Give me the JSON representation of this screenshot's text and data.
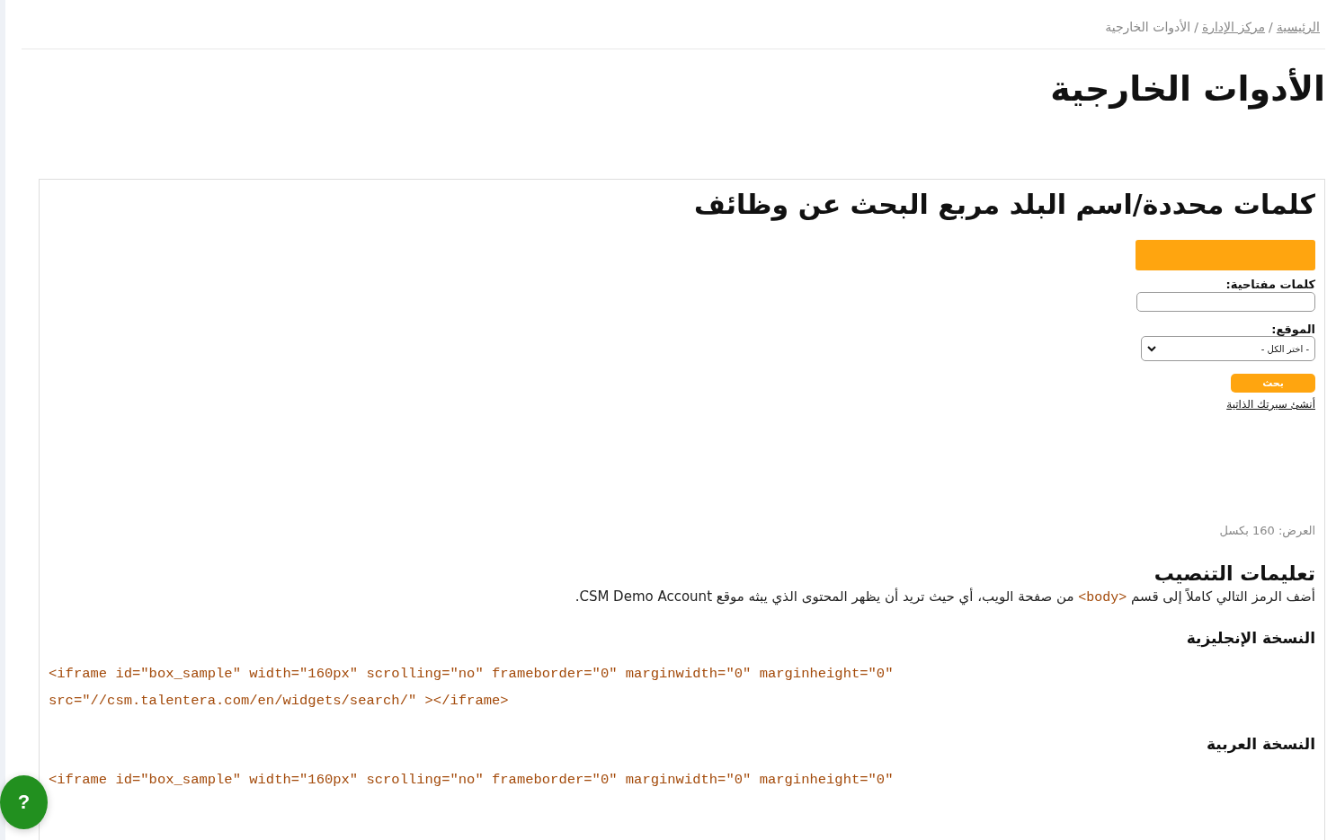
{
  "breadcrumb_separator": "/",
  "breadcrumb": [
    {
      "label": "الرئيسية",
      "link": true
    },
    {
      "label": "مركز الإدارة",
      "link": true
    },
    {
      "label": "الأدوات الخارجية",
      "link": false
    }
  ],
  "page_title": "الأدوات الخارجية",
  "widget": {
    "title": "كلمات محددة/اسم البلد مربع البحث عن وظائف",
    "keywords_label": "كلمات مفتاحية:",
    "location_label": "الموقع:",
    "location_value": "- اختر الكل -",
    "search_button": "بحث",
    "cv_link": "أنشئ سيرتك الذاتية",
    "width_note": "العرض: 160 بكسل"
  },
  "instructions": {
    "title": "تعليمات التنصيب",
    "text": [
      {
        "kind": "text",
        "text": "أضف الرمز التالي كاملاً إلى قسم "
      },
      {
        "kind": "code",
        "text": "<body>"
      },
      {
        "kind": "text",
        "text": " من صفحة الويب، أي حيث تريد أن يظهر المحتوى الذي يبثه موقع CSM Demo Account."
      }
    ]
  },
  "versions": [
    {
      "title": "النسخة الإنجليزية",
      "code_lines": [
        "<iframe id=\"box_sample\" width=\"160px\" scrolling=\"no\" frameborder=\"0\" marginwidth=\"0\" marginheight=\"0\"",
        "src=\"//csm.talentera.com/en/widgets/search/\" ></iframe>"
      ]
    },
    {
      "title": "النسخة العربية",
      "code_lines": [
        "<iframe id=\"box_sample\" width=\"160px\" scrolling=\"no\" frameborder=\"0\" marginwidth=\"0\" marginheight=\"0\""
      ]
    }
  ],
  "help_button": "?"
}
